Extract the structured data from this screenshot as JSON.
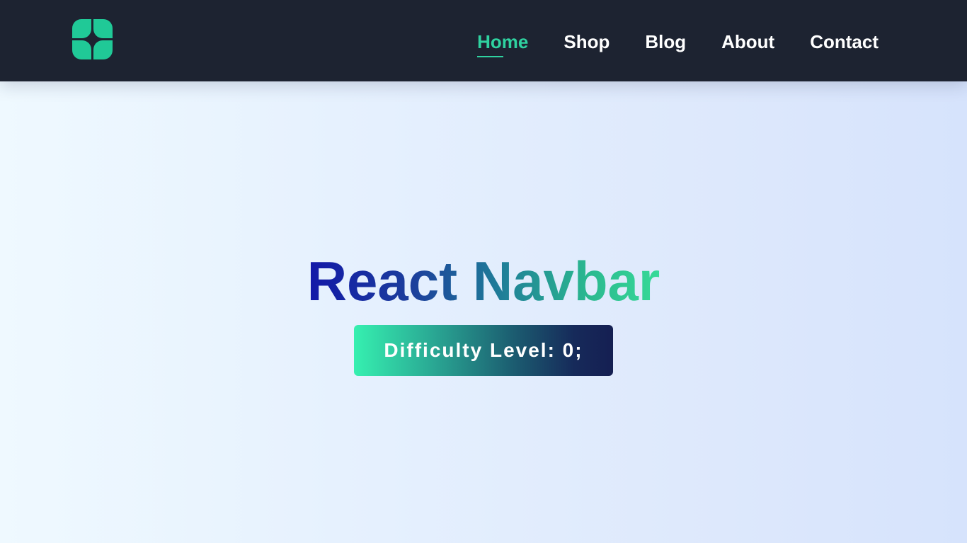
{
  "navbar": {
    "logo_icon": "four-petal-logo-icon",
    "logo_color": "#20c997",
    "links": [
      {
        "label": "Home",
        "active": true
      },
      {
        "label": "Shop",
        "active": false
      },
      {
        "label": "Blog",
        "active": false
      },
      {
        "label": "About",
        "active": false
      },
      {
        "label": "Contact",
        "active": false
      }
    ],
    "active_color": "#2fd2a0",
    "background": "#1d2331"
  },
  "hero": {
    "title": "React Navbar",
    "badge_text": "Difficulty Level: 0;"
  }
}
